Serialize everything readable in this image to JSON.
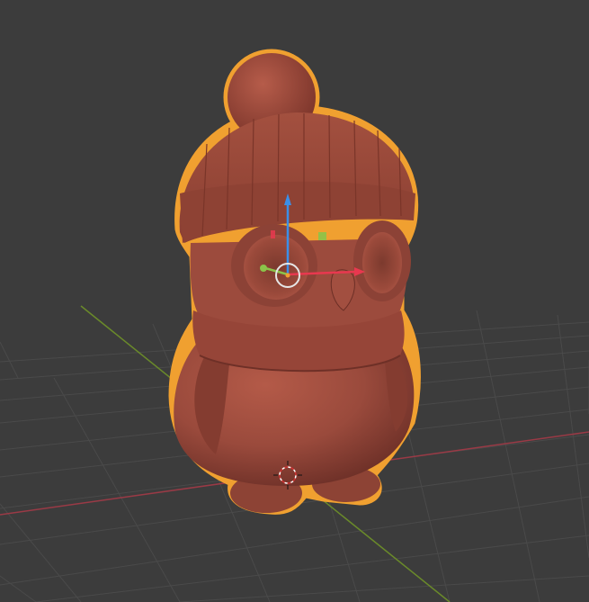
{
  "viewport": {
    "background_color": "#3c3c3c",
    "grid_color": "#4a4a4a",
    "x_axis_color": "#9a3a46",
    "y_axis_color": "#6a8a2a"
  },
  "object": {
    "description": "owl",
    "selected": true,
    "base_color": "#9a4a3c",
    "selection_outline_color": "#f0a030"
  },
  "gizmo": {
    "x_color": "#e8384f",
    "y_color": "#8bc34a",
    "z_color": "#3b8fe8"
  },
  "icons": {
    "origin": "object-origin-icon",
    "cursor": "3d-cursor-icon"
  }
}
